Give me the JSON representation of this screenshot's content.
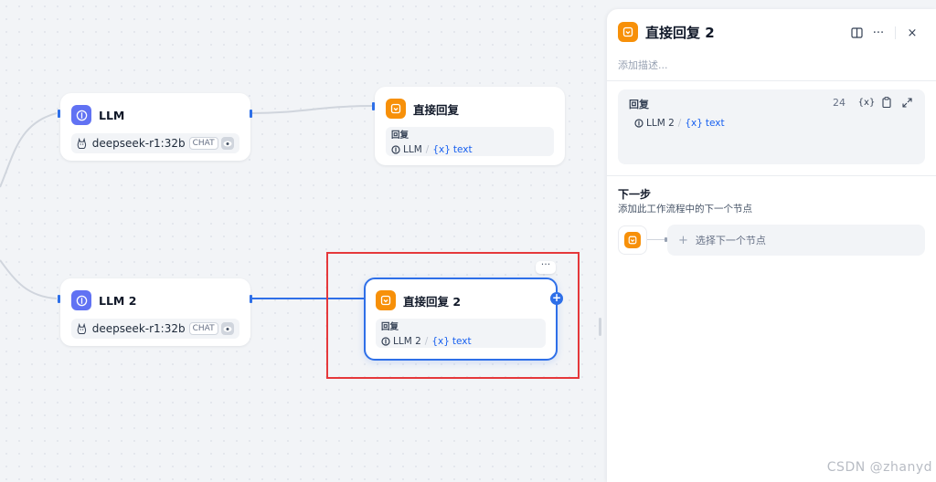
{
  "colors": {
    "accent": "#2e6fe8",
    "llm_icon": "#6172f3",
    "answer_icon": "#f79009",
    "highlight": "#e5383b"
  },
  "nodes": {
    "llm1": {
      "title": "LLM",
      "model": "deepseek-r1:32b",
      "mode_badge": "CHAT",
      "icon": "llm-brain-icon"
    },
    "answer1": {
      "title": "直接回复",
      "reply_label": "回复",
      "var_node": "LLM",
      "var_x": "{x}",
      "var_name": "text",
      "icon": "answer-icon"
    },
    "llm2": {
      "title": "LLM 2",
      "model": "deepseek-r1:32b",
      "mode_badge": "CHAT",
      "icon": "llm-brain-icon"
    },
    "answer2": {
      "title": "直接回复 2",
      "reply_label": "回复",
      "var_node": "LLM 2",
      "var_x": "{x}",
      "var_name": "text",
      "more": "···",
      "plus": "+",
      "icon": "answer-icon"
    }
  },
  "panel": {
    "title": "直接回复 2",
    "description_placeholder": "添加描述...",
    "tools": {
      "more": "···",
      "close": "×"
    },
    "reply": {
      "label": "回复",
      "count": "24",
      "var_x_tool": "{x}",
      "var_node": "LLM 2",
      "var_x": "{x}",
      "var_name": "text"
    },
    "next_step": {
      "title": "下一步",
      "description": "添加此工作流程中的下一个节点",
      "plus": "+",
      "select_label": "选择下一个节点"
    }
  },
  "watermark": "CSDN @zhanyd"
}
